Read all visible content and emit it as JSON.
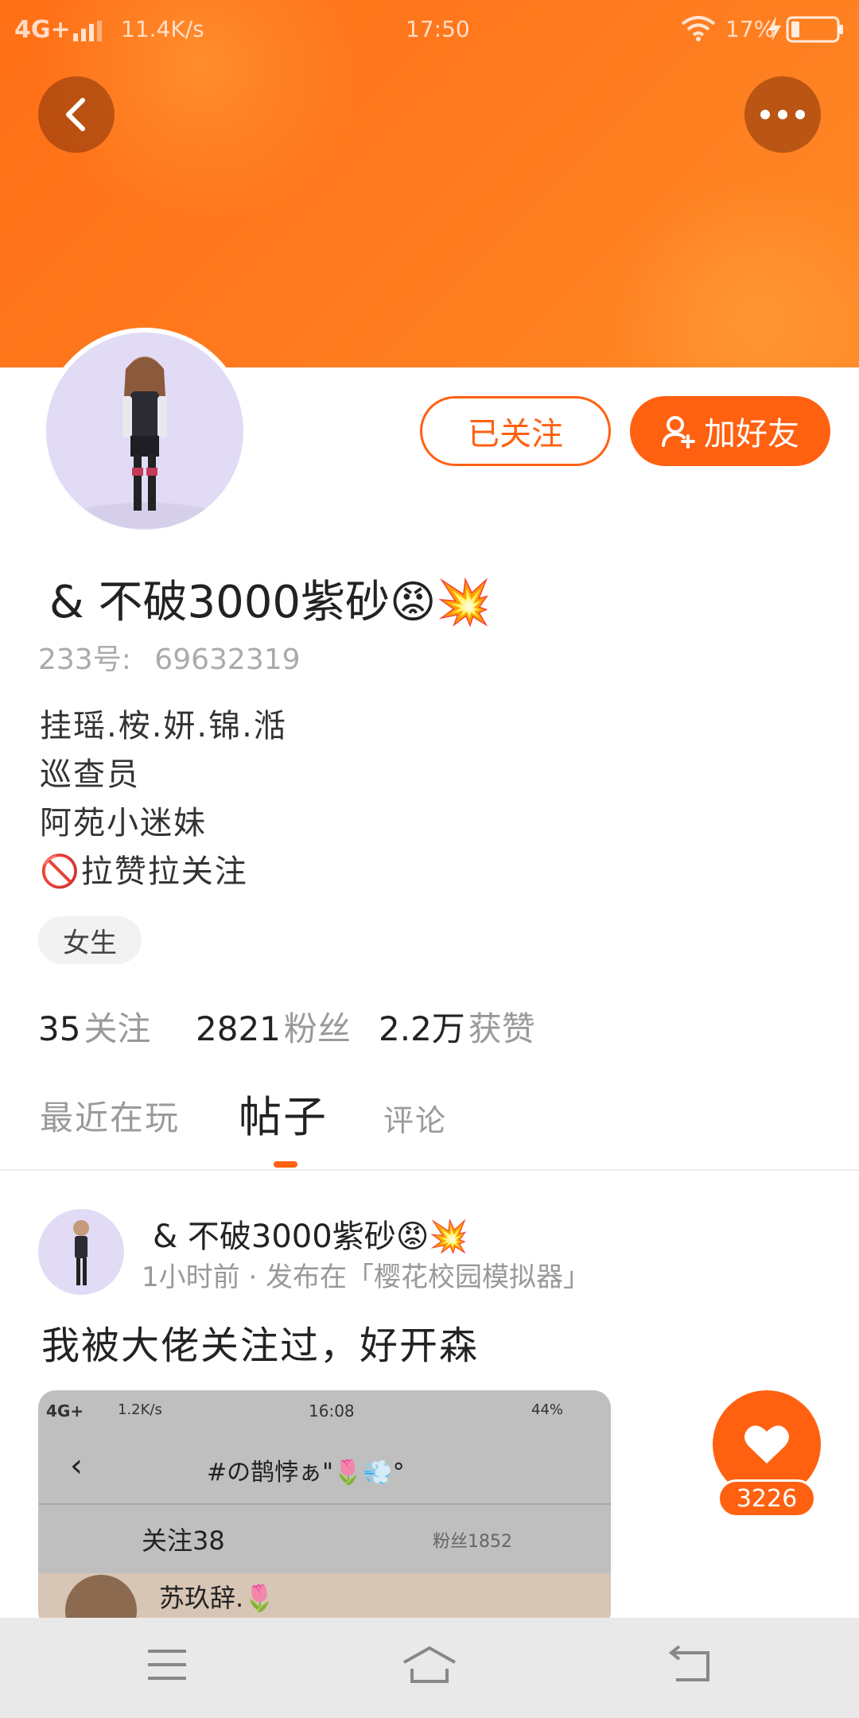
{
  "status_bar": {
    "network": "4G+",
    "speed": "11.4K/s",
    "time": "17:50",
    "battery": "17%"
  },
  "profile": {
    "name": "& 不破3000紫砂😡💥",
    "id_label": "233号:",
    "id_value": "69632319",
    "bio": [
      "挂瑶.桉.妍.锦.湉",
      "巡查员",
      "阿苑小迷妹",
      "🚫拉赞拉关注"
    ],
    "gender_tag": "女生"
  },
  "actions": {
    "followed_label": "已关注",
    "add_friend_label": "加好友"
  },
  "stats": [
    {
      "num": "35",
      "label": "关注"
    },
    {
      "num": "2821",
      "label": "粉丝"
    },
    {
      "num": "2.2万",
      "label": "获赞"
    }
  ],
  "tabs": [
    {
      "label": "最近在玩",
      "active": false
    },
    {
      "label": "帖子",
      "active": true
    },
    {
      "label": "评论",
      "active": false
    }
  ],
  "post": {
    "author": "& 不破3000紫砂😡💥",
    "meta": "1小时前 · 发布在「樱花校园模拟器」",
    "text": "我被大佬关注过，好开森",
    "like_count": "3226",
    "embedded": {
      "network": "4G+",
      "speed": "1.2K/s",
      "time": "16:08",
      "battery": "44%",
      "title": "#の鹊悖ぁ\"🌷💨°",
      "tab_following": "关注38",
      "tab_fans": "粉丝1852",
      "first_user": "苏玖辞.🌷"
    }
  },
  "colors": {
    "accent": "#ff6111",
    "header": "#ff7a1e"
  }
}
